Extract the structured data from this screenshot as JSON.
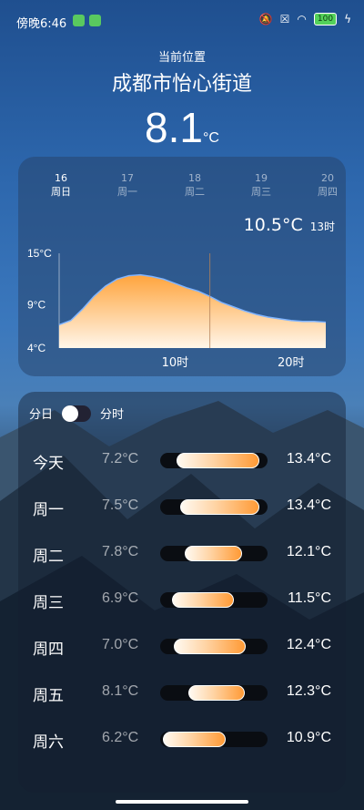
{
  "status": {
    "time": "傍晚6:46",
    "battery": "100"
  },
  "location": {
    "label": "当前位置",
    "name": "成都市怡心街道"
  },
  "current": {
    "temp": "8.1",
    "unit": "°C"
  },
  "days": [
    {
      "num": "16",
      "name": "周日",
      "active": true
    },
    {
      "num": "17",
      "name": "周一"
    },
    {
      "num": "18",
      "name": "周二"
    },
    {
      "num": "19",
      "name": "周三"
    },
    {
      "num": "20",
      "name": "周四"
    }
  ],
  "hour_detail": {
    "temp": "10.5°C",
    "hour": "13时"
  },
  "chart_data": {
    "type": "area",
    "y_ticks": [
      "15°C",
      "9°C",
      "4°C"
    ],
    "ylim": [
      4,
      15
    ],
    "x_ticks": [
      {
        "label": "10时",
        "x": 10
      },
      {
        "label": "20时",
        "x": 20
      }
    ],
    "x": [
      0,
      1,
      2,
      3,
      4,
      5,
      6,
      7,
      8,
      9,
      10,
      11,
      12,
      13,
      14,
      15,
      16,
      17,
      18,
      19,
      20,
      21,
      22,
      23
    ],
    "values": [
      6.7,
      7.2,
      8.5,
      10.0,
      11.2,
      12.0,
      12.4,
      12.5,
      12.3,
      12.0,
      11.5,
      11.0,
      10.6,
      10.0,
      9.3,
      8.8,
      8.3,
      7.9,
      7.6,
      7.4,
      7.2,
      7.1,
      7.1,
      7.0
    ],
    "marker_x": 13
  },
  "forecast": {
    "toggle_left": "分日",
    "toggle_right": "分时",
    "scale": [
      6,
      14
    ],
    "rows": [
      {
        "day": "今天",
        "low": "7.2°C",
        "high": "13.4°C",
        "lo": 7.2,
        "hi": 13.4
      },
      {
        "day": "周一",
        "low": "7.5°C",
        "high": "13.4°C",
        "lo": 7.5,
        "hi": 13.4
      },
      {
        "day": "周二",
        "low": "7.8°C",
        "high": "12.1°C",
        "lo": 7.8,
        "hi": 12.1
      },
      {
        "day": "周三",
        "low": "6.9°C",
        "high": "11.5°C",
        "lo": 6.9,
        "hi": 11.5
      },
      {
        "day": "周四",
        "low": "7.0°C",
        "high": "12.4°C",
        "lo": 7.0,
        "hi": 12.4
      },
      {
        "day": "周五",
        "low": "8.1°C",
        "high": "12.3°C",
        "lo": 8.1,
        "hi": 12.3
      },
      {
        "day": "周六",
        "low": "6.2°C",
        "high": "10.9°C",
        "lo": 6.2,
        "hi": 10.9
      }
    ]
  }
}
